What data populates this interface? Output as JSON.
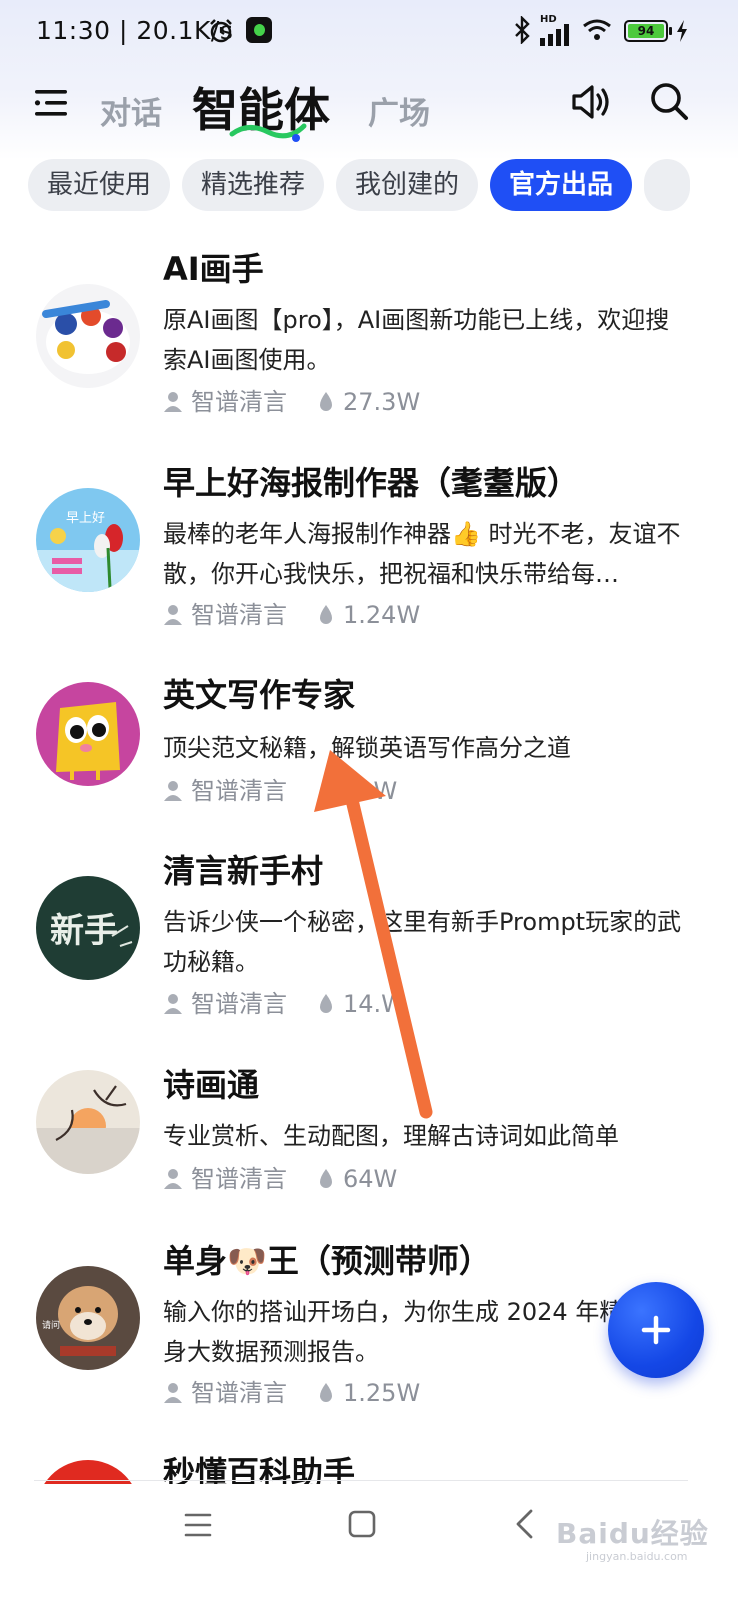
{
  "status_bar": {
    "time": "11:30",
    "speed": "20.1K/s",
    "hd_label": "HD",
    "battery_level": "94",
    "icons": [
      "alarm-icon",
      "app-notification-icon",
      "bluetooth-icon",
      "signal-icon",
      "wifi-icon",
      "battery-icon",
      "charging-icon"
    ]
  },
  "header": {
    "tabs": [
      "对话",
      "智能体",
      "广场"
    ],
    "active_tab": "智能体",
    "icons": [
      "menu-icon",
      "sound-icon",
      "search-icon"
    ]
  },
  "filters": {
    "chips": [
      "最近使用",
      "精选推荐",
      "我创建的",
      "官方出品"
    ],
    "active": "官方出品"
  },
  "agents": [
    {
      "title": "AI画手",
      "desc": "原AI画图【pro】，AI画图新功能已上线，欢迎搜索AI画图使用。",
      "author": "智谱清言",
      "uses": "27.3W"
    },
    {
      "title": "早上好海报制作器（耄耋版）",
      "desc": "最棒的老年人海报制作神器👍 时光不老，友谊不散，你开心我快乐，把祝福和快乐带给每…",
      "author": "智谱清言",
      "uses": "1.24W",
      "avatar_text": "早上好"
    },
    {
      "title": "英文写作专家",
      "desc": "顶尖范文秘籍，解锁英语写作高分之道",
      "author": "智谱清言",
      "uses": "41W"
    },
    {
      "title": "清言新手村",
      "desc": "告诉少侠一个秘密，这里有新手Prompt玩家的武功秘籍。",
      "author": "智谱清言",
      "uses": "14.W",
      "avatar_text": "新手"
    },
    {
      "title": "诗画通",
      "desc": "专业赏析、生动配图，理解古诗词如此简单",
      "author": "智谱清言",
      "uses": "64W"
    },
    {
      "title": "单身🐶王（预测带师）",
      "desc": "输入你的搭讪开场白，为你生成 2024 年精准单身大数据预测报告。",
      "author": "智谱清言",
      "uses": "1.25W",
      "avatar_text": "请问"
    },
    {
      "title": "秒懂百科助手"
    }
  ],
  "fab": {
    "icon": "plus-icon"
  },
  "nav": {
    "icons": [
      "nav-menu-icon",
      "nav-home-icon",
      "nav-back-icon"
    ]
  },
  "watermark": {
    "text": "Baidu经验",
    "sub": "jingyan.baidu.com"
  },
  "colors": {
    "accent": "#1f4ff5",
    "arrow": "#f2703a",
    "chip_bg": "#eceef2"
  }
}
